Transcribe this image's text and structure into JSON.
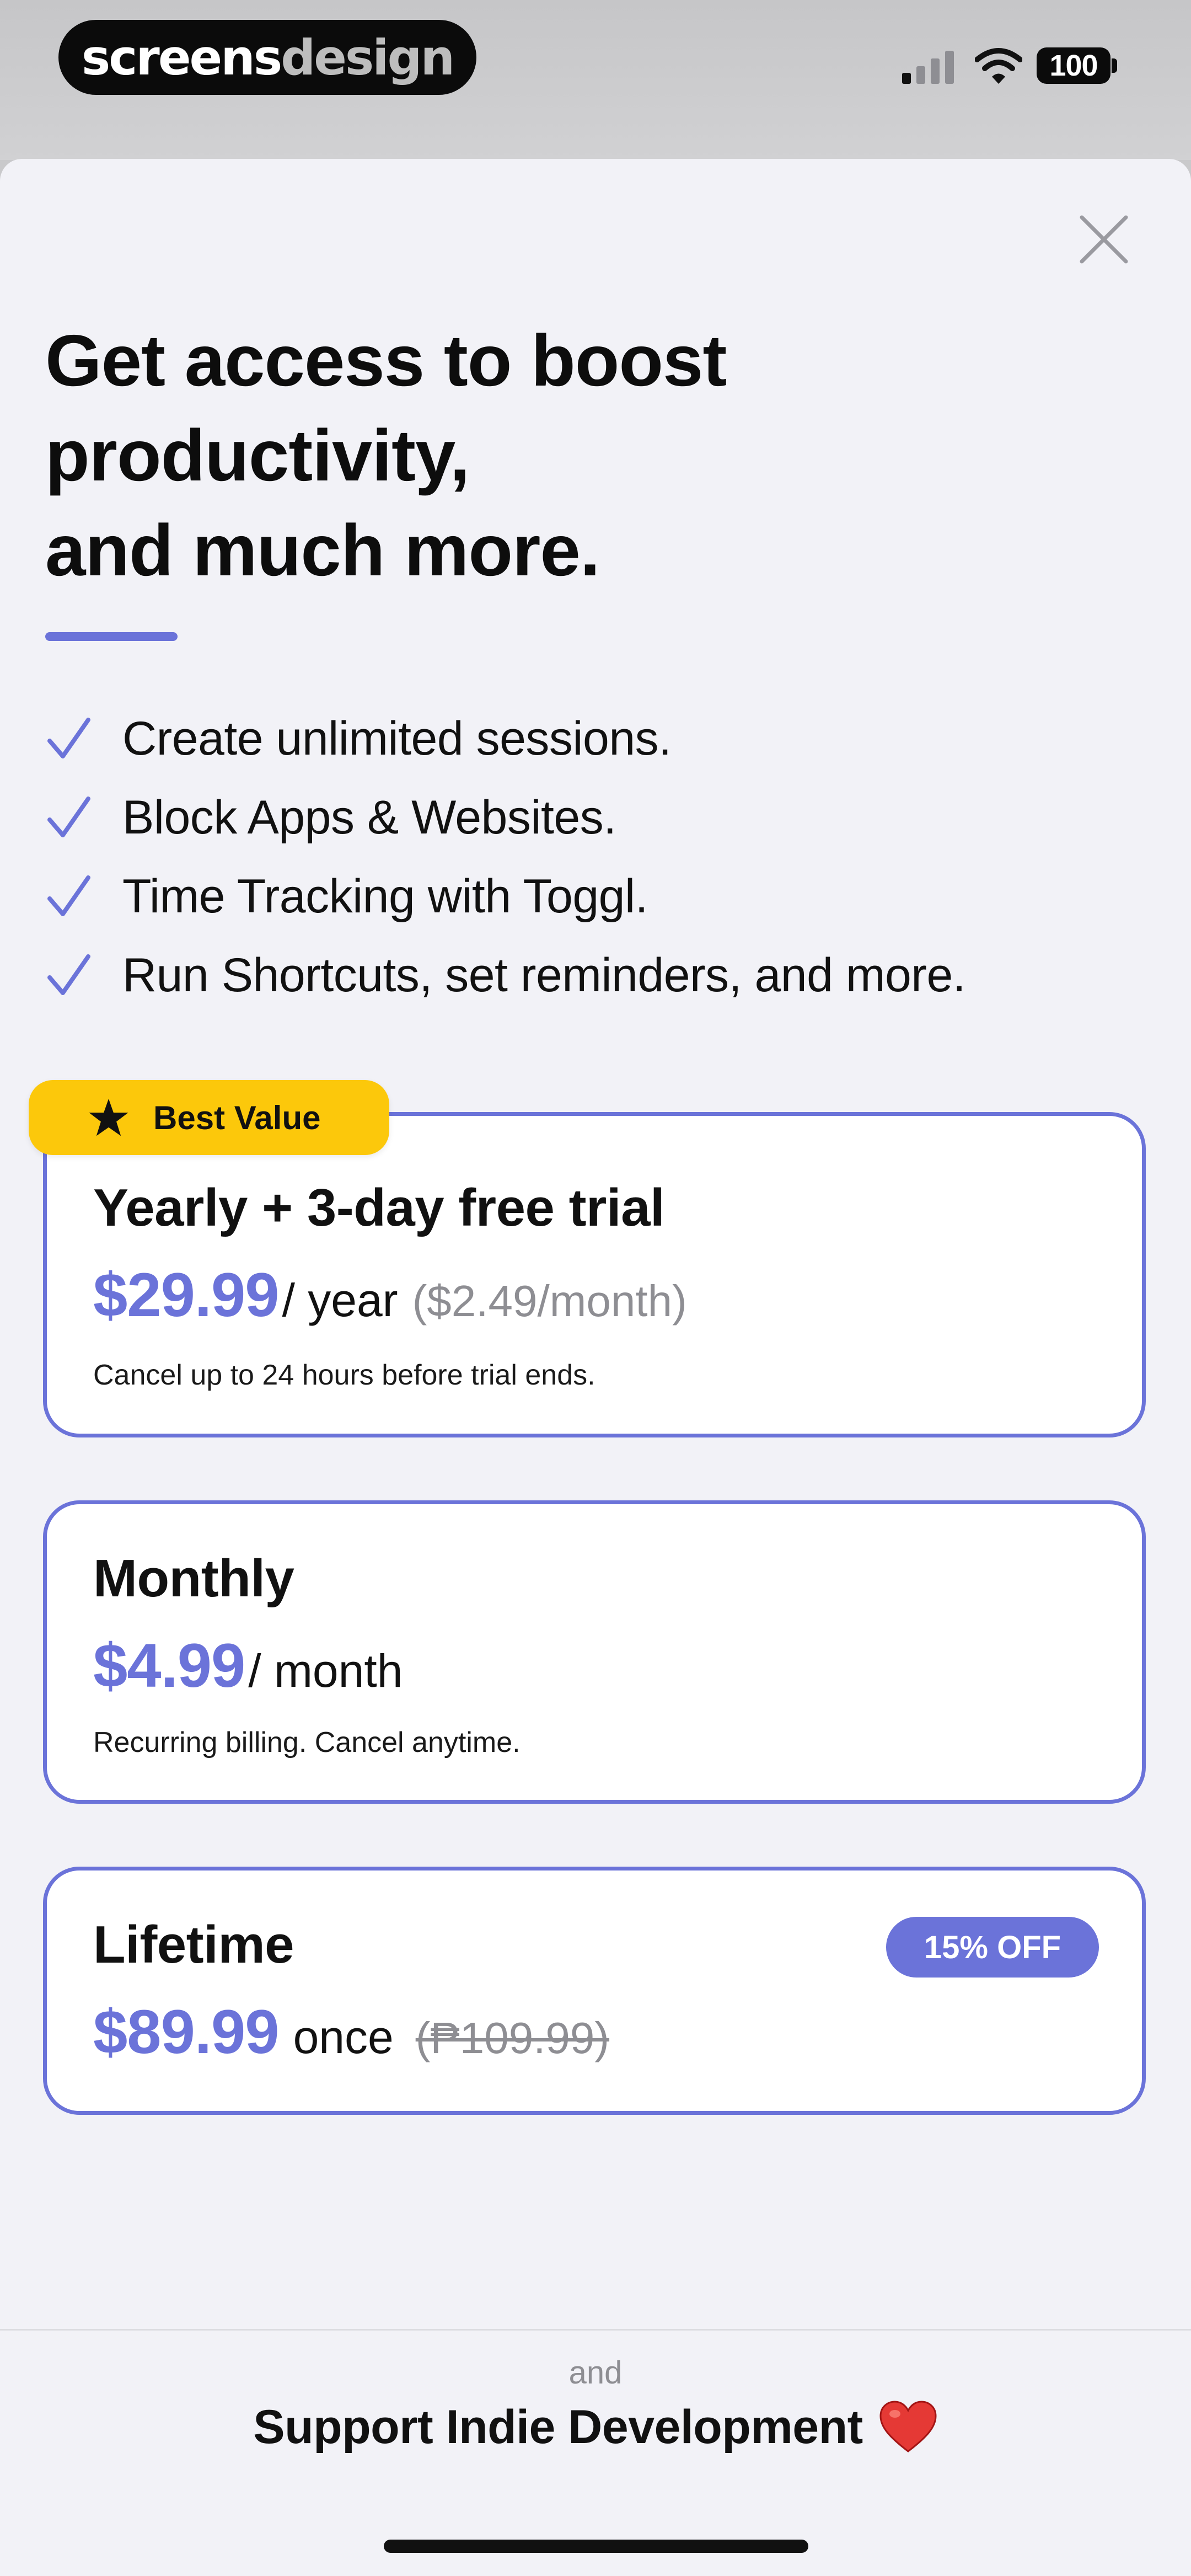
{
  "status_bar": {
    "logo_primary": "screens",
    "logo_secondary": "design",
    "battery_level": "100",
    "icons": [
      "cellular-signal-icon",
      "wifi-icon",
      "battery-icon"
    ]
  },
  "paywall": {
    "headline_lines": [
      "Get access to boost",
      "productivity,",
      "and much more."
    ],
    "features": [
      "Create unlimited sessions.",
      "Block Apps & Websites.",
      "Time Tracking with Toggl.",
      "Run Shortcuts, set reminders, and more."
    ],
    "plans": {
      "yearly": {
        "badge": "Best Value",
        "name": "Yearly + 3-day free trial",
        "price": "$29.99",
        "unit": "/ year",
        "per_month": "($2.49/month)",
        "note": "Cancel up to 24 hours before trial ends."
      },
      "monthly": {
        "name": "Monthly",
        "price": "$4.99",
        "unit": "/ month",
        "note": "Recurring billing. Cancel anytime."
      },
      "lifetime": {
        "name": "Lifetime",
        "badge": "15% OFF",
        "price": "$89.99",
        "unit": "once",
        "original_price": "(₱109.99)"
      }
    },
    "footer": {
      "and_label": "and",
      "support_label": "Support Indie Development"
    }
  },
  "colors": {
    "accent": "#6b73d9",
    "badge_yellow": "#fcc80b",
    "background": "#f2f2f7",
    "card": "#ffffff",
    "heart": "#e53935"
  }
}
